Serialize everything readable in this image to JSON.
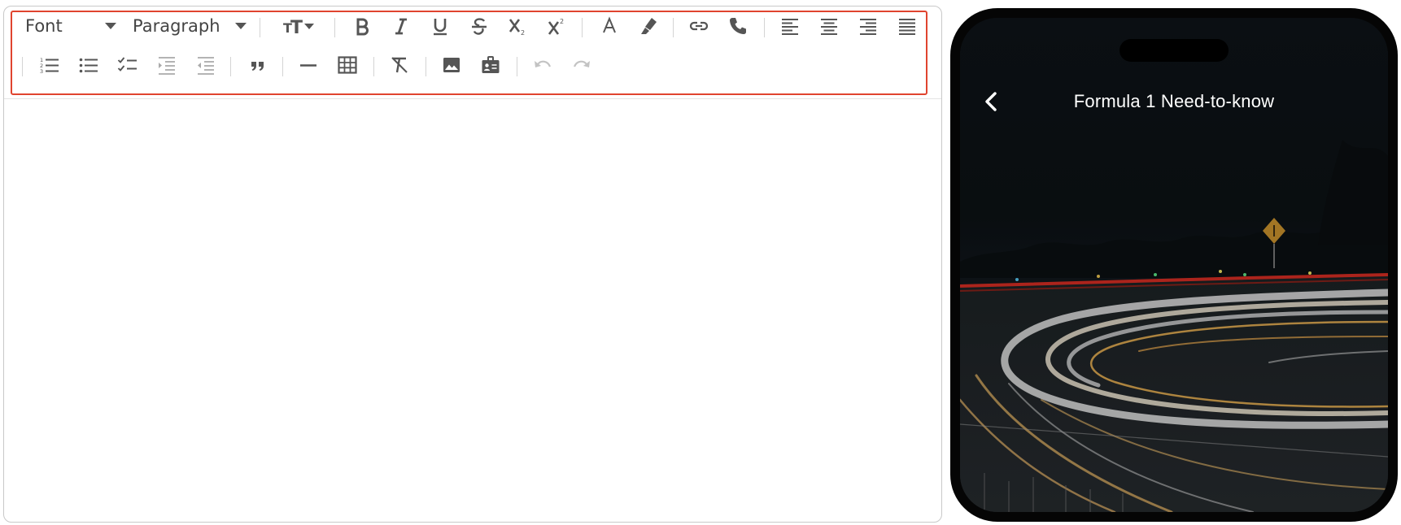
{
  "editor": {
    "font_select": "Font",
    "paragraph_select": "Paragraph",
    "content": ""
  },
  "toolbar": {
    "row1": [
      "font-size",
      "bold",
      "italic",
      "underline",
      "strikethrough",
      "subscript",
      "superscript",
      "font-color",
      "highlight",
      "link",
      "phone-link",
      "align-left",
      "align-center",
      "align-right",
      "align-justify"
    ],
    "row2": [
      "ordered-list",
      "bullet-list",
      "checklist",
      "indent",
      "outdent",
      "blockquote",
      "horizontal-rule",
      "table",
      "clear-format",
      "image",
      "contact-card",
      "undo",
      "redo"
    ],
    "disabled": [
      "undo",
      "redo"
    ]
  },
  "phone": {
    "title": "Formula 1 Need-to-know"
  },
  "colors": {
    "highlight_outline": "#e0442f",
    "icon": "#555555",
    "phone_frame": "#050505"
  }
}
